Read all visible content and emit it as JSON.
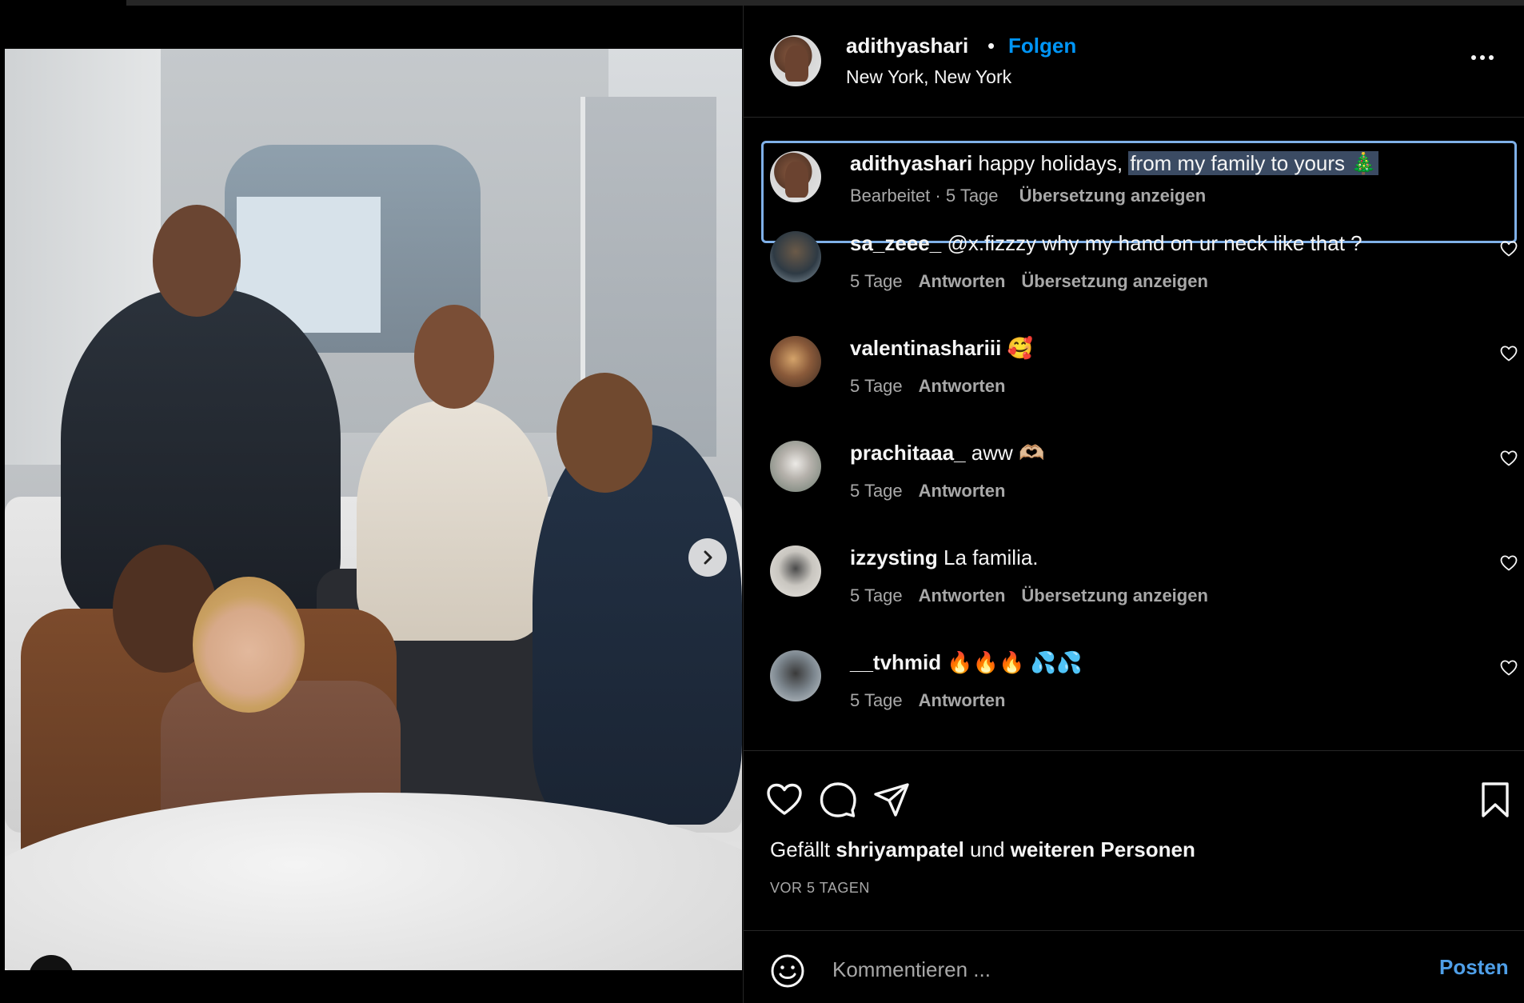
{
  "post": {
    "username": "adithyashari",
    "separator": "•",
    "follow_label": "Folgen",
    "location": "New York, New York"
  },
  "caption": {
    "username": "adithyashari",
    "text_plain": "happy holidays, ",
    "text_highlighted": "from my family to yours 🎄",
    "edited": "Bearbeitet",
    "dot": "·",
    "time": "5 Tage",
    "translate": "Übersetzung anzeigen"
  },
  "comments": [
    {
      "username": "sa_zeee_",
      "text": "@x.fizzzy why my hand on ur neck like that ?",
      "time": "5 Tage",
      "reply": "Antworten",
      "translate": "Übersetzung anzeigen"
    },
    {
      "username": "valentinashariii",
      "text": "🥰",
      "time": "5 Tage",
      "reply": "Antworten",
      "translate": ""
    },
    {
      "username": "prachitaaa_",
      "text": "aww 🫶🏼",
      "time": "5 Tage",
      "reply": "Antworten",
      "translate": ""
    },
    {
      "username": "izzysting",
      "text": "La familia.",
      "time": "5 Tage",
      "reply": "Antworten",
      "translate": "Übersetzung anzeigen"
    },
    {
      "username": "__tvhmid",
      "text": "🔥🔥🔥 💦💦",
      "time": "5 Tage",
      "reply": "Antworten",
      "translate": ""
    }
  ],
  "likes": {
    "prefix": "Gefällt",
    "user": "shriyampatel",
    "middle": "und",
    "rest": "weiteren Personen"
  },
  "posted_ago": "VOR 5 TAGEN",
  "comment_box": {
    "placeholder": "Kommentieren ...",
    "post_label": "Posten"
  },
  "carousel": {
    "slide_count": 3,
    "active_slide": 1
  },
  "colors": {
    "accent": "#0095f6",
    "post_button": "#4f9fe8",
    "background": "#000000",
    "secondary_text": "#a8a8a8",
    "selection_border": "#7fb0e8"
  },
  "icons": [
    "more-icon",
    "next-arrow-icon",
    "user-tag-icon",
    "heart-icon",
    "comment-icon",
    "share-icon",
    "bookmark-icon",
    "emoji-icon"
  ]
}
